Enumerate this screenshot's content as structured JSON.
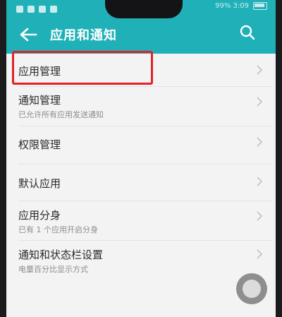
{
  "header": {
    "title": "应用和通知"
  },
  "status_bar": {
    "right_text": "99% 3:09"
  },
  "menu": {
    "items": [
      {
        "label": "应用管理",
        "subtitle": ""
      },
      {
        "label": "通知管理",
        "subtitle": "已允许所有应用发送通知"
      },
      {
        "label": "权限管理",
        "subtitle": ""
      },
      {
        "label": "默认应用",
        "subtitle": ""
      },
      {
        "label": "应用分身",
        "subtitle": "已有 1 个应用开启分身"
      },
      {
        "label": "通知和状态栏设置",
        "subtitle": "电量百分比显示方式"
      }
    ]
  },
  "colors": {
    "appbar": "#20b1b8",
    "highlight_box": "#e0242a",
    "background": "#f3f3f3"
  },
  "icons": {
    "back": "arrow-left",
    "search": "magnifier",
    "chevron": "chevron-right"
  }
}
